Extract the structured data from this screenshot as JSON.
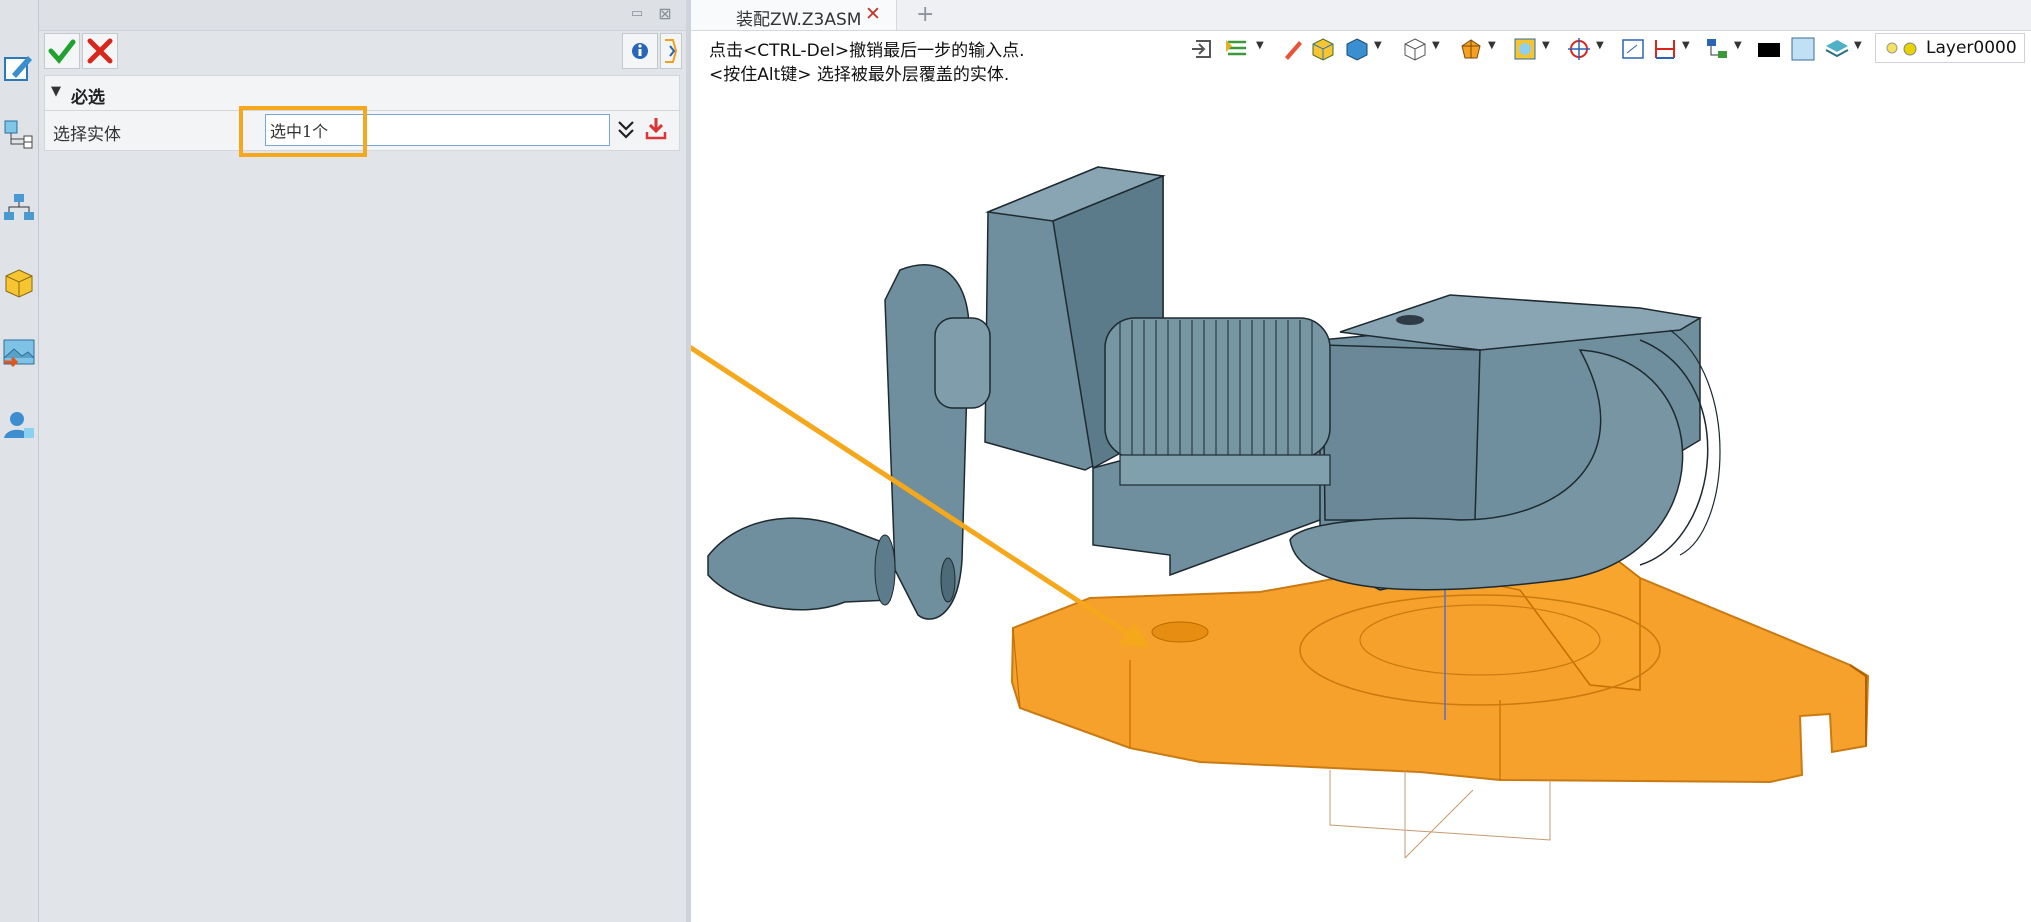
{
  "panel": {
    "toolbar": {
      "ok_icon": "check-icon",
      "cancel_icon": "close-icon",
      "info_icon": "info-icon",
      "pin_icon": "pin-icon"
    },
    "section": {
      "title": "必选",
      "row_label": "选择实体",
      "input_value": "选中1个"
    }
  },
  "tabs": {
    "active_label": "装配ZW.Z3ASM",
    "close_glyph": "✕",
    "new_tab_glyph": "+"
  },
  "viewport": {
    "prompt_line1": "点击<CTRL-Del>撤销最后一步的输入点.",
    "prompt_line2": "<按住Alt键> 选择被最外层覆盖的实体.",
    "layer": "Layer0000"
  },
  "colors": {
    "highlight": "#f5a81c",
    "selected_part": "#f59a1a",
    "model_part": "#6f8f9e",
    "panel_bg": "#e1e4e8"
  }
}
